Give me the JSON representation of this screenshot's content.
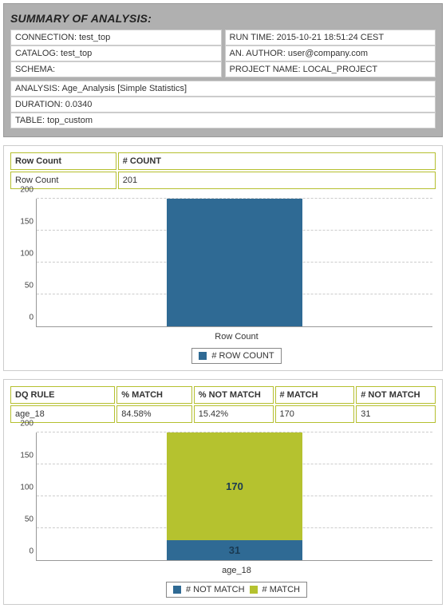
{
  "summary": {
    "title": "SUMMARY OF ANALYSIS:",
    "connection_label": "CONNECTION: ",
    "connection_value": "test_top",
    "catalog_label": "CATALOG: ",
    "catalog_value": "test_top",
    "schema_label": "SCHEMA:",
    "schema_value": "",
    "runtime_label": "RUN TIME: ",
    "runtime_value": "2015-10-21 18:51:24 CEST",
    "author_label": "AN. AUTHOR: ",
    "author_value": "user@company.com",
    "projectname_label": "PROJECT NAME: ",
    "projectname_value": "LOCAL_PROJECT",
    "analysis_label": "ANALYSIS: ",
    "analysis_value": "Age_Analysis [Simple Statistics]",
    "duration_label": "DURATION: ",
    "duration_value": "0.0340",
    "table_label": "TABLE: ",
    "table_value": "top_custom"
  },
  "rowcount_table": {
    "col1": "Row Count",
    "col2": "# COUNT",
    "r1c1": "Row Count",
    "r1c2": "201"
  },
  "chart1": {
    "xlabel": "Row Count",
    "legend": "# ROW COUNT",
    "ticks": {
      "t0": "0",
      "t50": "50",
      "t100": "100",
      "t150": "150",
      "t200": "200"
    }
  },
  "dq_table": {
    "c1": "DQ RULE",
    "c2": "% MATCH",
    "c3": "% NOT MATCH",
    "c4": "# MATCH",
    "c5": "# NOT MATCH",
    "r1c1": "age_18",
    "r1c2": "84.58%",
    "r1c3": "15.42%",
    "r1c4": "170",
    "r1c5": "31"
  },
  "chart2": {
    "xlabel": "age_18",
    "legend_notmatch": "# NOT MATCH",
    "legend_match": "# MATCH",
    "match_label": "170",
    "notmatch_label": "31",
    "ticks": {
      "t0": "0",
      "t50": "50",
      "t100": "100",
      "t150": "150",
      "t200": "200"
    }
  },
  "chart_data": [
    {
      "type": "bar",
      "title": "",
      "categories": [
        "Row Count"
      ],
      "series": [
        {
          "name": "# ROW COUNT",
          "values": [
            201
          ]
        }
      ],
      "ylim": [
        0,
        200
      ],
      "xlabel": "",
      "ylabel": ""
    },
    {
      "type": "bar",
      "stacked": true,
      "title": "",
      "categories": [
        "age_18"
      ],
      "series": [
        {
          "name": "# NOT MATCH",
          "values": [
            31
          ]
        },
        {
          "name": "# MATCH",
          "values": [
            170
          ]
        }
      ],
      "ylim": [
        0,
        200
      ],
      "xlabel": "",
      "ylabel": ""
    }
  ]
}
